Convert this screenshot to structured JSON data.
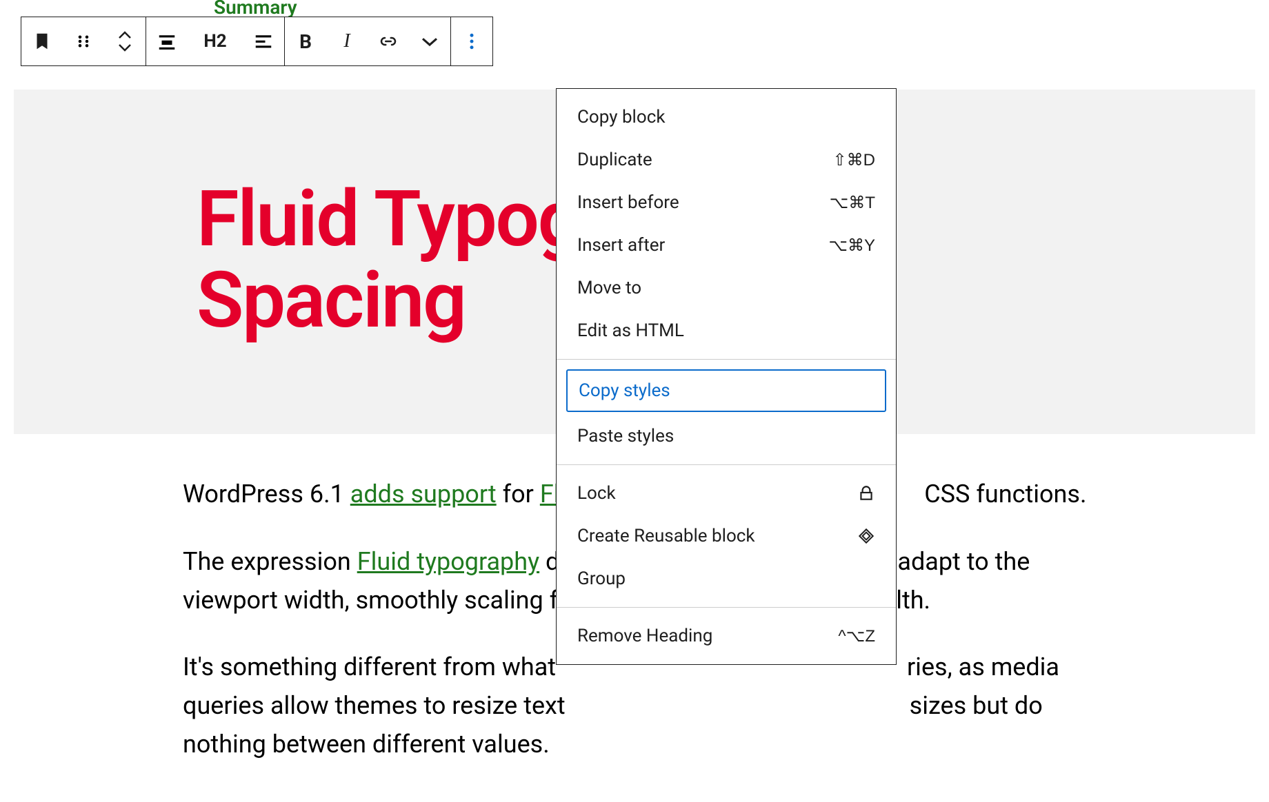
{
  "topFragment": "Summary",
  "toolbar": {
    "heading_label": "H2",
    "bold_label": "B",
    "italic_label": "I"
  },
  "hero": {
    "title_line1": "Fluid Typogr",
    "title_line2": "Spacing"
  },
  "body": {
    "p1_a": "WordPress 6.1 ",
    "p1_link1": "adds support",
    "p1_b": " for ",
    "p1_link2": "Flu",
    "p1_c": " CSS functions.",
    "p2_a": "The expression ",
    "p2_link1": "Fluid typography",
    "p2_b": " d",
    "p2_c": "adapt to the viewport width, smoothly scaling f",
    "p2_d": "lth.",
    "p3_a": "It's something different from what ",
    "p3_b": "ries, as media queries allow themes to resize text",
    "p3_c": " sizes but do nothing between different values."
  },
  "menu": {
    "copy_block": "Copy block",
    "duplicate": {
      "label": "Duplicate",
      "shortcut": "⇧⌘D"
    },
    "insert_before": {
      "label": "Insert before",
      "shortcut": "⌥⌘T"
    },
    "insert_after": {
      "label": "Insert after",
      "shortcut": "⌥⌘Y"
    },
    "move_to": "Move to",
    "edit_html": "Edit as HTML",
    "copy_styles": "Copy styles",
    "paste_styles": "Paste styles",
    "lock": "Lock",
    "reusable": "Create Reusable block",
    "group": "Group",
    "remove": {
      "label": "Remove Heading",
      "shortcut": "^⌥Z"
    }
  }
}
